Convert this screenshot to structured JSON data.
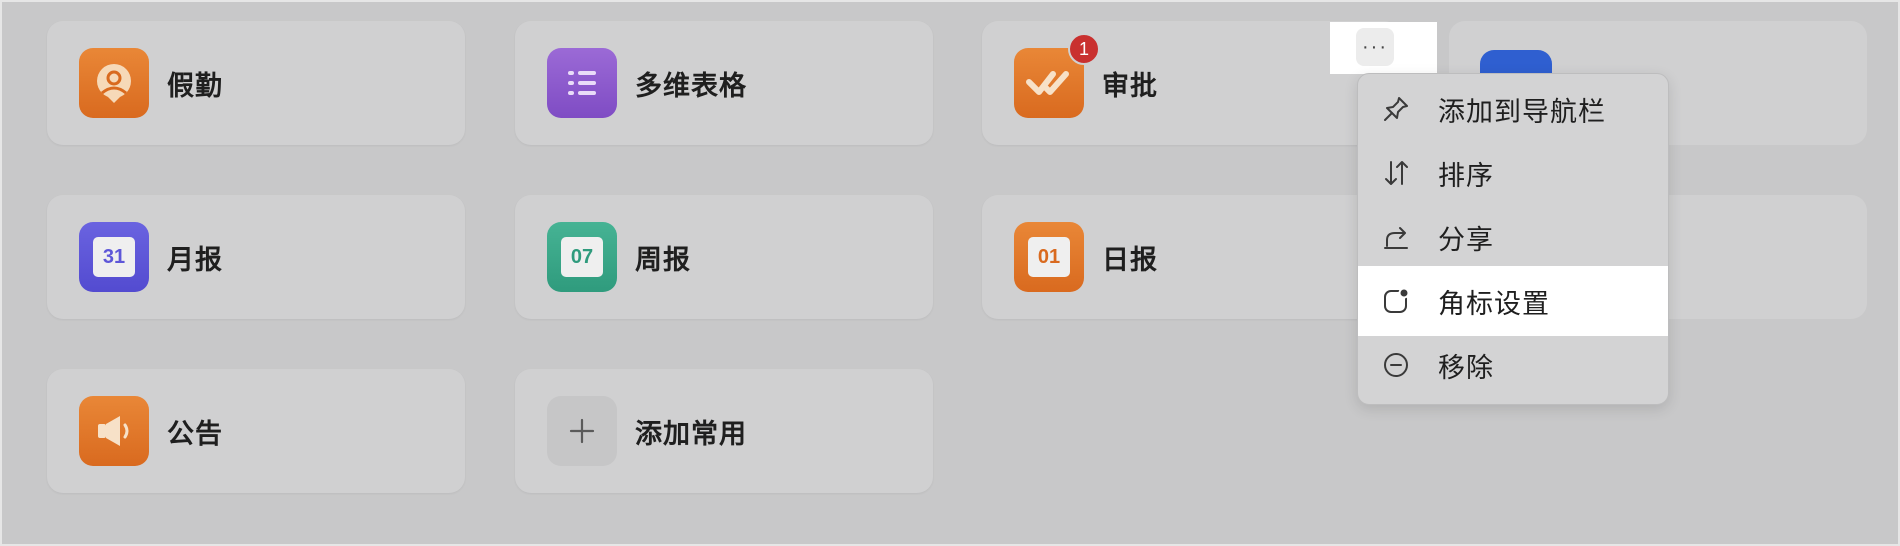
{
  "apps": [
    {
      "label": "假勤",
      "icon": "attendance-icon"
    },
    {
      "label": "多维表格",
      "icon": "table-list-icon"
    },
    {
      "label": "审批",
      "icon": "approval-icon",
      "badge": "1"
    },
    {
      "label": "月报",
      "icon": "calendar-icon",
      "date": "31"
    },
    {
      "label": "周报",
      "icon": "calendar-icon",
      "date": "07"
    },
    {
      "label": "日报",
      "icon": "calendar-icon",
      "date": "01"
    },
    {
      "label": "公告",
      "icon": "megaphone-icon"
    },
    {
      "label": "添加常用",
      "icon": "plus-icon"
    }
  ],
  "more_button": {
    "label": "···"
  },
  "context_menu": {
    "items": [
      {
        "label": "添加到导航栏",
        "icon": "pin-icon"
      },
      {
        "label": "排序",
        "icon": "sort-arrows-icon"
      },
      {
        "label": "分享",
        "icon": "share-icon"
      },
      {
        "label": "角标设置",
        "icon": "badge-settings-icon",
        "highlighted": true
      },
      {
        "label": "移除",
        "icon": "remove-icon"
      }
    ]
  },
  "colors": {
    "overlay": "#c8c8c9",
    "card": "#d0d0d1",
    "badge": "#c9302f",
    "orange": "#e07a2c",
    "purple": "#8b5ccf",
    "indigo": "#5e57d8",
    "teal": "#3aa888",
    "blue": "#2f5fd0"
  }
}
